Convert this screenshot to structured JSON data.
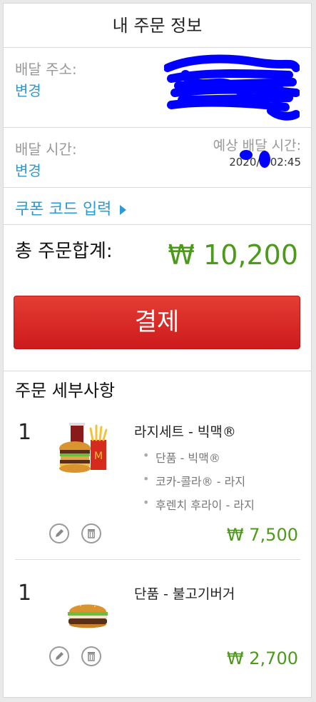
{
  "header": {
    "title": "내 주문 정보"
  },
  "address": {
    "label": "배달 주소:",
    "change": "변경"
  },
  "delivery": {
    "label": "배달 시간:",
    "change": "변경",
    "est_label": "예상 배달 시간:",
    "est_time": "2020/0   02:45"
  },
  "coupon": {
    "label": "쿠폰 코드 입력",
    "icon": "triangle-right-icon"
  },
  "total": {
    "label": "총 주문합계:",
    "amount": "₩ 10,200"
  },
  "pay": {
    "label": "결제"
  },
  "details": {
    "heading": "주문 세부사항",
    "items": [
      {
        "qty": "1",
        "name": "라지세트 - 빅맥®",
        "subs": [
          "단품 - 빅맥®",
          "코카-콜라® - 라지",
          "후렌치 후라이 - 라지"
        ],
        "price": "₩ 7,500"
      },
      {
        "qty": "1",
        "name": "단품 - 불고기버거",
        "subs": [],
        "price": "₩ 2,700"
      }
    ]
  },
  "colors": {
    "accent_blue": "#2a9bd6",
    "price_green": "#4c9a1a",
    "pay_red": "#d82a26",
    "redaction": "#0000ff"
  }
}
